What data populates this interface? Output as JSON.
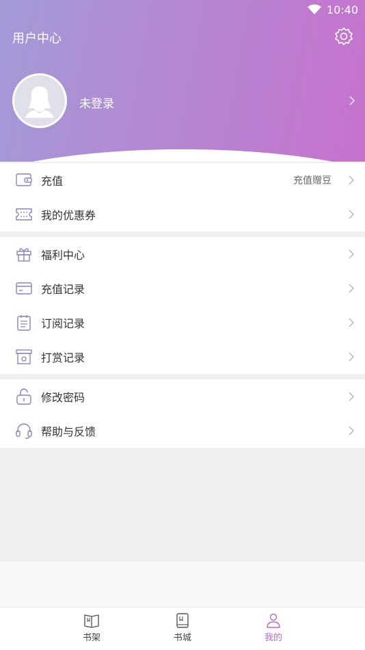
{
  "status": {
    "time": "10:40"
  },
  "header": {
    "title": "用户中心",
    "login_text": "未登录"
  },
  "menu": {
    "group1": [
      {
        "label": "充值",
        "hint": "充值赠豆",
        "icon": "wallet-icon"
      },
      {
        "label": "我的优惠券",
        "icon": "coupon-icon"
      }
    ],
    "group2": [
      {
        "label": "福利中心",
        "icon": "gift-icon"
      },
      {
        "label": "充值记录",
        "icon": "card-icon"
      },
      {
        "label": "订阅记录",
        "icon": "clipboard-icon"
      },
      {
        "label": "打赏记录",
        "icon": "box-icon"
      }
    ],
    "group3": [
      {
        "label": "修改密码",
        "icon": "lock-icon"
      },
      {
        "label": "帮助与反馈",
        "icon": "headset-icon"
      }
    ]
  },
  "tabs": [
    {
      "label": "书架",
      "icon": "bookshelf-icon"
    },
    {
      "label": "书城",
      "icon": "bookstore-icon"
    },
    {
      "label": "我的",
      "icon": "user-icon",
      "active": true
    }
  ],
  "colors": {
    "accent": "#b66ac9",
    "icon_stroke": "#8a82b8",
    "gradient_start": "#a49ad6",
    "gradient_end": "#c672cc"
  }
}
